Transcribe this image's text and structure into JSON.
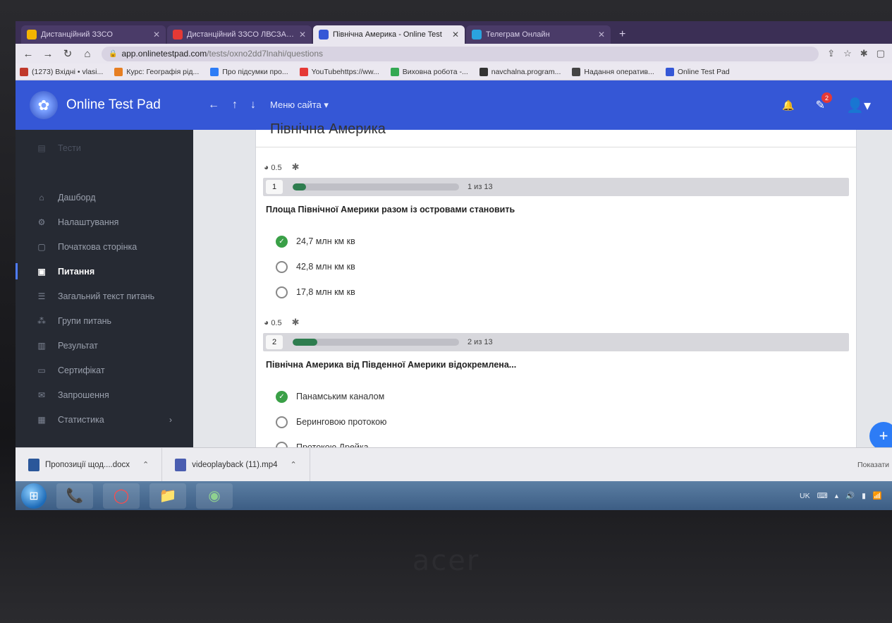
{
  "browser": {
    "tabs": [
      {
        "label": "Дистанційний ЗЗСО",
        "active": false,
        "icon": "classroom-icon"
      },
      {
        "label": "Дистанційний ЗЗСО ЛВСЗАНС",
        "active": false,
        "icon": "image-icon"
      },
      {
        "label": "Північна Америка - Online Test",
        "active": true,
        "icon": "onlinetestpad-icon"
      },
      {
        "label": "Телеграм Онлайн",
        "active": false,
        "icon": "telegram-icon"
      }
    ],
    "new_tab_symbol": "+",
    "url_host": "app.onlinetestpad.com",
    "url_path": "/tests/oxno2dd7lnahi/questions",
    "bookmarks": [
      {
        "label": "(1273) Вхідні • vlasi...",
        "color": "#c0392b"
      },
      {
        "label": "Курс: Географія рід...",
        "color": "#e67e22"
      },
      {
        "label": "Про підсумки про...",
        "color": "#2d7cf6"
      },
      {
        "label": "YouTubehttps://ww...",
        "color": "#e53935"
      },
      {
        "label": "Виховна робота -...",
        "color": "#34a853"
      },
      {
        "label": "navchalna.program...",
        "color": "#333333"
      },
      {
        "label": "Надання оператив...",
        "color": "#444444"
      },
      {
        "label": "Online Test Pad",
        "color": "#3557d6"
      }
    ]
  },
  "header": {
    "app_name": "Online Test Pad",
    "menu_label": "Меню сайта",
    "chat_badge": "2",
    "accent_color": "#3557d6"
  },
  "sidebar": {
    "items": [
      {
        "label": "Тести",
        "icon": "tests-icon",
        "active": false,
        "dim": true
      },
      {
        "label": "Дашборд",
        "icon": "dashboard-icon",
        "active": false,
        "dim": false
      },
      {
        "label": "Налаштування",
        "icon": "gear-icon",
        "active": false,
        "dim": false
      },
      {
        "label": "Початкова сторінка",
        "icon": "page-icon",
        "active": false,
        "dim": false
      },
      {
        "label": "Питання",
        "icon": "question-icon",
        "active": true,
        "dim": false
      },
      {
        "label": "Загальний текст питань",
        "icon": "text-icon",
        "active": false,
        "dim": false
      },
      {
        "label": "Групи питань",
        "icon": "groups-icon",
        "active": false,
        "dim": false
      },
      {
        "label": "Результат",
        "icon": "results-icon",
        "active": false,
        "dim": false
      },
      {
        "label": "Сертифікат",
        "icon": "certificate-icon",
        "active": false,
        "dim": false
      },
      {
        "label": "Запрошення",
        "icon": "invite-icon",
        "active": false,
        "dim": false
      },
      {
        "label": "Статистика",
        "icon": "stats-icon",
        "active": false,
        "dim": false,
        "chevron": "›"
      }
    ]
  },
  "main": {
    "test_title": "Північна Америка",
    "questions": [
      {
        "points": "0.5",
        "number": "1",
        "progress_fraction": 0.08,
        "count_label": "1 из 13",
        "text": "Площа Північної Америки разом із островами становить",
        "answers": [
          {
            "label": "24,7 млн км кв",
            "correct": true
          },
          {
            "label": "42,8 млн  км кв",
            "correct": false
          },
          {
            "label": "17,8 млн км кв",
            "correct": false
          }
        ]
      },
      {
        "points": "0.5",
        "number": "2",
        "progress_fraction": 0.15,
        "count_label": "2 из 13",
        "text": "Північна Америка  від Південної Америки відокремлена...",
        "answers": [
          {
            "label": "Панамським каналом",
            "correct": true
          },
          {
            "label": "Беринговою протокою",
            "correct": false
          },
          {
            "label": "Протокою Дрейка",
            "correct": false
          }
        ]
      }
    ]
  },
  "downloads": {
    "items": [
      {
        "label": "Пропозиції щод....docx",
        "color": "#2b579a"
      },
      {
        "label": "videoplayback (11).mp4",
        "color": "#4a5db0"
      }
    ],
    "show_all": "Показати"
  },
  "taskbar": {
    "apps": [
      "viber-icon",
      "opera-icon",
      "folder-icon",
      "chrome-icon"
    ],
    "tray_lang": "UK"
  },
  "bezel_brand": "acer"
}
